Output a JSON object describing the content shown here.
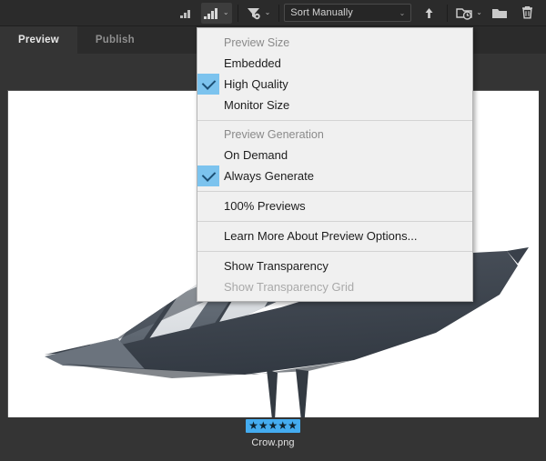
{
  "toolbar": {
    "thumbnail_small_icon": "thumbnail-small-icon",
    "thumbnail_large_icon": "thumbnail-large-icon",
    "filter_icon": "filter-icon",
    "sort": {
      "value": "Sort Manually",
      "chevron": "⌄"
    },
    "sort_direction_icon": "arrow-up-icon",
    "recent_folders_icon": "recent-folders-icon",
    "new_folder_icon": "new-folder-icon",
    "delete_icon": "trash-icon",
    "chevron": "⌄"
  },
  "tabs": [
    {
      "label": "Preview",
      "selected": true
    },
    {
      "label": "Publish",
      "selected": false
    }
  ],
  "file": {
    "name": "Crow.png",
    "rating": 5,
    "star_glyph": "★"
  },
  "menu": {
    "items": [
      {
        "label": "Preview Size",
        "type": "header",
        "checked": false
      },
      {
        "label": "Embedded",
        "type": "item",
        "checked": false
      },
      {
        "label": "High Quality",
        "type": "item",
        "checked": true
      },
      {
        "label": "Monitor Size",
        "type": "item",
        "checked": false
      },
      {
        "label": "",
        "type": "separator",
        "checked": false
      },
      {
        "label": "Preview Generation",
        "type": "header",
        "checked": false
      },
      {
        "label": "On Demand",
        "type": "item",
        "checked": false
      },
      {
        "label": "Always Generate",
        "type": "item",
        "checked": true
      },
      {
        "label": "",
        "type": "separator",
        "checked": false
      },
      {
        "label": "100% Previews",
        "type": "item",
        "checked": false
      },
      {
        "label": "",
        "type": "separator",
        "checked": false
      },
      {
        "label": "Learn More About Preview Options...",
        "type": "item",
        "checked": false
      },
      {
        "label": "",
        "type": "separator",
        "checked": false
      },
      {
        "label": "Show Transparency",
        "type": "item",
        "checked": false
      },
      {
        "label": "Show Transparency Grid",
        "type": "disabled",
        "checked": false
      }
    ]
  },
  "colors": {
    "chrome": "#2b2b2b",
    "panel": "#343434",
    "canvas": "#ffffff",
    "menu_bg": "#f0f0f0",
    "check_highlight": "#7cc3ee",
    "rating_bg": "#44acf0",
    "bird_dark": "#3f4750",
    "bird_mid": "#6e7780",
    "bird_light": "#e8eaec"
  }
}
